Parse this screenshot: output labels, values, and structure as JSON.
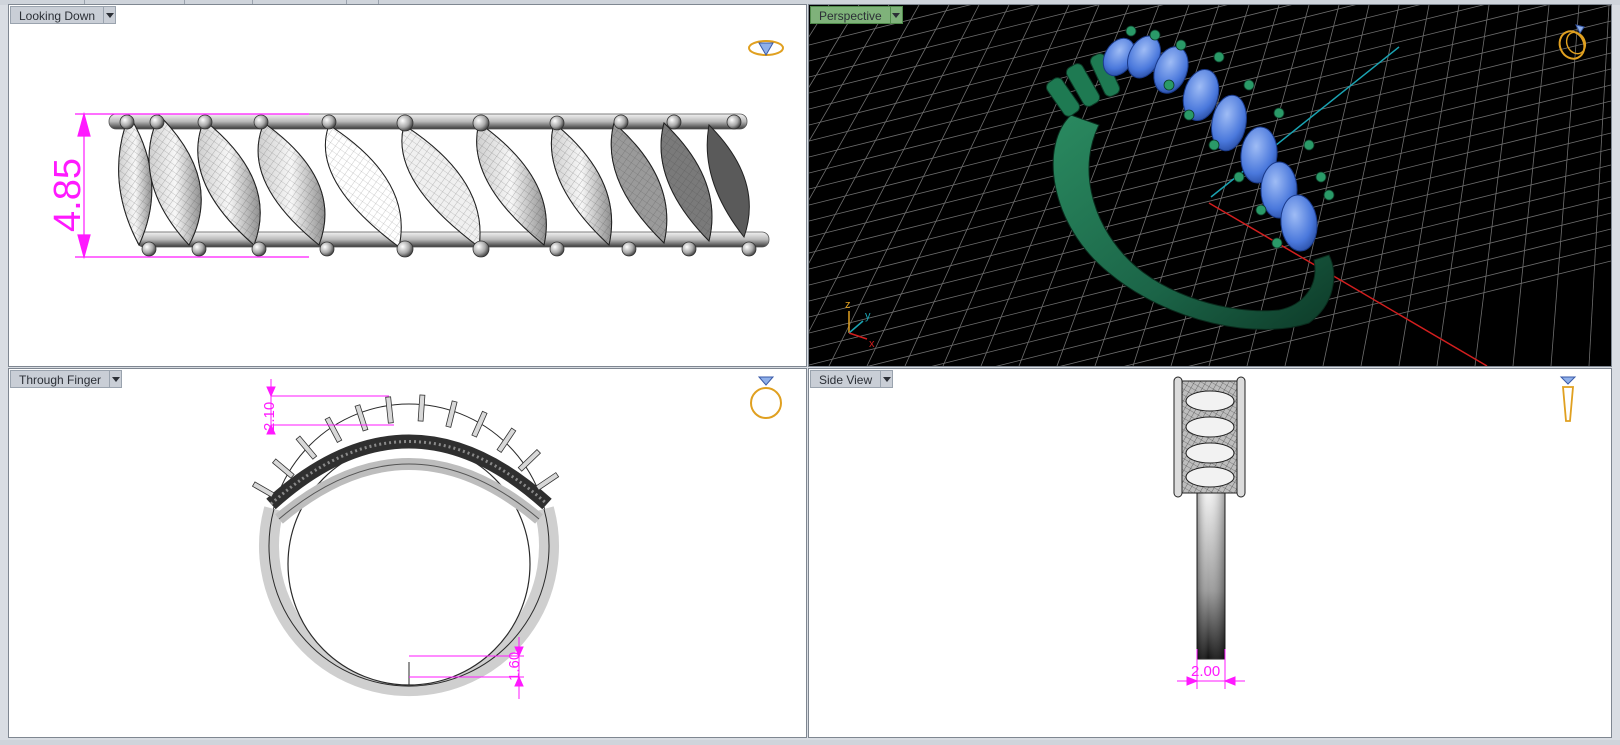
{
  "viewports": {
    "top_left": {
      "label": "Looking Down",
      "dimension": "4.85"
    },
    "top_right": {
      "label": "Perspective",
      "axes": {
        "z": "z",
        "y": "y",
        "x": "x"
      }
    },
    "bottom_left": {
      "label": "Through Finger",
      "dimension_top": "2.10",
      "dimension_bottom": "1.60"
    },
    "bottom_right": {
      "label": "Side View",
      "dimension": "2.00"
    }
  },
  "icons": {
    "view_down": "ring-top-view-icon",
    "view_perspective": "ring-perspective-icon",
    "view_through": "ring-front-view-icon",
    "view_side": "ring-side-view-icon",
    "dropdown": "chevron-down-icon"
  },
  "colors": {
    "dimension": "#ff19ff",
    "metal_perspective": "#1e6e4e",
    "gems_perspective": "#5a86e0",
    "axis_red": "#d21e1e",
    "axis_cyan": "#1aa3b2",
    "icon_gold": "#e0a020"
  }
}
